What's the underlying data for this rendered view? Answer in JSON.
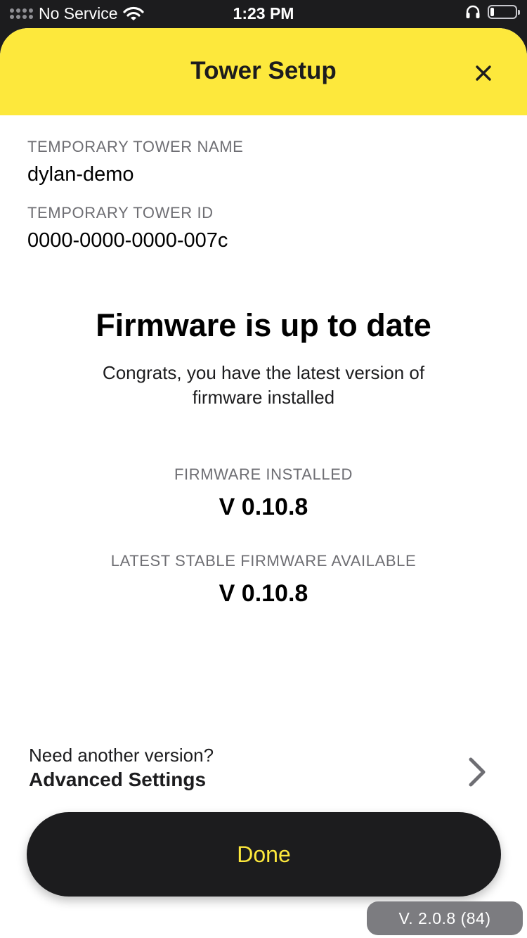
{
  "status_bar": {
    "carrier": "No Service",
    "time": "1:23 PM",
    "wifi_icon": "wifi-icon",
    "headphones_icon": "headphones-icon",
    "battery_icon": "battery-icon"
  },
  "header": {
    "title": "Tower Setup",
    "close_icon": "close-icon",
    "background_color": "#fde83c"
  },
  "tower": {
    "name_label": "TEMPORARY TOWER NAME",
    "name_value": "dylan-demo",
    "id_label": "TEMPORARY TOWER ID",
    "id_value": "0000-0000-0000-007c"
  },
  "firmware": {
    "heading": "Firmware is up to date",
    "message": "Congrats, you have the latest version of firmware installed",
    "installed_label": "FIRMWARE INSTALLED",
    "installed_value": "V 0.10.8",
    "latest_label": "LATEST STABLE FIRMWARE AVAILABLE",
    "latest_value": "V 0.10.8"
  },
  "advanced": {
    "hint": "Need another version?",
    "title": "Advanced Settings",
    "chevron_icon": "chevron-right-icon"
  },
  "actions": {
    "done_label": "Done",
    "accent_color": "#fde83c"
  },
  "app_version": "V.  2.0.8 (84)"
}
